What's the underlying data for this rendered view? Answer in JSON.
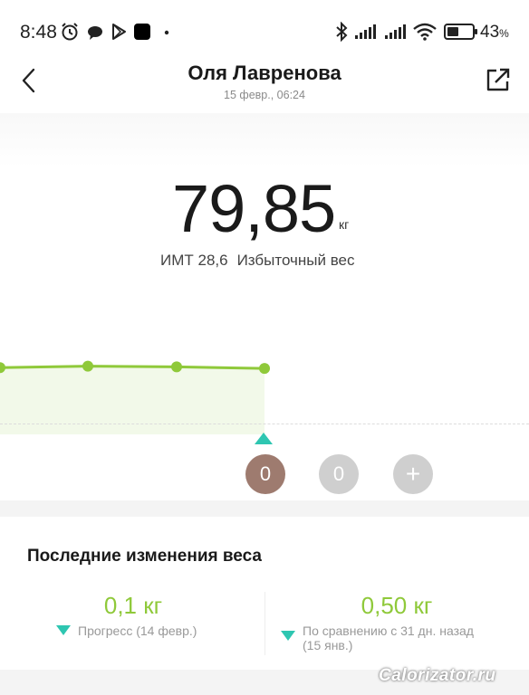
{
  "status_bar": {
    "time": "8:48",
    "battery_percent": "43",
    "battery_suffix": "%",
    "icons": [
      "alarm-icon",
      "chat-bubble-icon",
      "play-store-icon",
      "black-square-icon",
      "dot-icon",
      "bluetooth-icon",
      "signal-icon",
      "signal-icon",
      "wifi-icon",
      "battery-icon"
    ]
  },
  "header": {
    "title": "Оля Лавренова",
    "subtitle": "15 февр., 06:24",
    "back_icon": "chevron-left-icon",
    "share_icon": "share-icon"
  },
  "measurement": {
    "weight": "79,85",
    "unit": "кг",
    "bmi_label": "ИМТ 28,6",
    "bmi_status": "Избыточный вес"
  },
  "chart_data": {
    "type": "line",
    "series": [
      {
        "values": [
          79.86,
          79.88,
          79.87,
          79.85
        ]
      }
    ],
    "color": "#8fc93a",
    "fill": "#f2f9e9"
  },
  "records": {
    "items": [
      {
        "label": "0",
        "state": "active"
      },
      {
        "label": "0",
        "state": "inactive"
      },
      {
        "label": "+",
        "state": "add"
      }
    ],
    "marker_color": "#2ec6b1"
  },
  "last_changes": {
    "title": "Последние изменения веса",
    "items": [
      {
        "value": "0,1 кг",
        "desc": "Прогресс (14 февр.)"
      },
      {
        "value": "0,50 кг",
        "desc_line1": "По сравнению с 31 дн. назад",
        "desc_line2": "(15 янв.)"
      }
    ]
  },
  "watermark": "Calorizator.ru",
  "colors": {
    "accent_green": "#8fc93a",
    "teal": "#2ec6b1",
    "active_record": "#9e7b6f"
  }
}
